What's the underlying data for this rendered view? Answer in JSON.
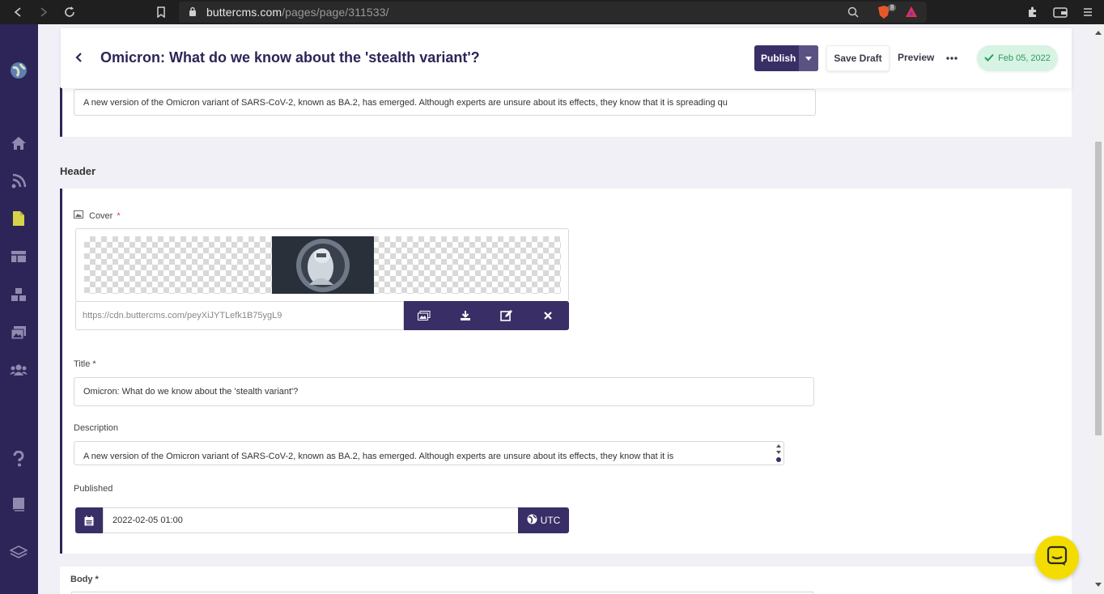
{
  "browser": {
    "url_host": "buttercms.com",
    "url_path": "/pages/page/311533/",
    "brave_badge": "8"
  },
  "header": {
    "title": "Omicron: What do we know about the 'stealth variant'?",
    "publish_label": "Publish",
    "save_draft_label": "Save Draft",
    "preview_label": "Preview",
    "status_date": "Feb 05, 2022"
  },
  "summary_field": {
    "value": "A new version of the Omicron variant of SARS-CoV-2, known as BA.2, has emerged. Although experts are unsure about its effects, they know that it is spreading qu"
  },
  "section": {
    "header_label": "Header"
  },
  "cover": {
    "label": "Cover",
    "required_mark": "*",
    "url": "https://cdn.buttercms.com/peyXiJYTLefk1B75ygL9"
  },
  "title_field": {
    "label": "Title *",
    "value": "Omicron: What do we know about the 'stealth variant'?"
  },
  "description_field": {
    "label": "Description",
    "value": "A new version of the Omicron variant of SARS-CoV-2, known as BA.2, has emerged. Although experts are unsure about its effects, they know that it is"
  },
  "published_field": {
    "label": "Published",
    "value": "2022-02-05 01:00",
    "timezone": "UTC"
  },
  "body_section": {
    "label": "Body *"
  },
  "colors": {
    "sidebar": "#2d2557",
    "accent": "#3a2e66",
    "status_green": "#2e9b61",
    "chat_yellow": "#f3dd00"
  }
}
